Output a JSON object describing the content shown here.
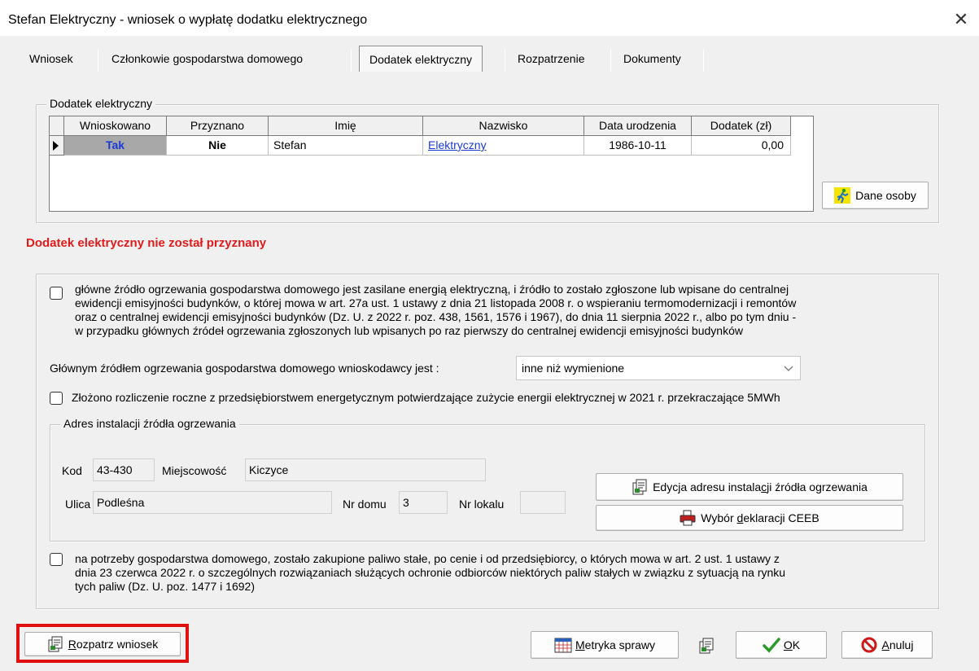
{
  "window": {
    "title": "Stefan Elektryczny - wniosek o wypłatę dodatku elektrycznego",
    "close_glyph": "✕"
  },
  "tabs": [
    {
      "label": "Wniosek",
      "active": false
    },
    {
      "label": "Członkowie gospodarstwa domowego",
      "active": false
    },
    {
      "label": "Dodatek elektryczny",
      "active": true
    },
    {
      "label": "Rozpatrzenie",
      "active": false
    },
    {
      "label": "Dokumenty",
      "active": false
    }
  ],
  "dodatek_group": {
    "label": "Dodatek elektryczny",
    "columns": [
      "Wnioskowano",
      "Przyznano",
      "Imię",
      "Nazwisko",
      "Data urodzenia",
      "Dodatek  (zł)"
    ],
    "rows": [
      {
        "wnioskowano": "Tak",
        "przyznano": "Nie",
        "imie": "Stefan",
        "nazwisko": "Elektryczny",
        "data_urodzenia": "1986-10-11",
        "dodatek": "0,00"
      }
    ],
    "dane_osoby_button": "Dane osoby"
  },
  "status_message": "Dodatek elektryczny nie został przyznany",
  "status_color": "#e01b1b",
  "conditions": {
    "heating_checkbox": {
      "checked": false,
      "lines": [
        "główne źródło ogrzewania gospodarstwa domowego jest zasilane energią elektryczną, i źródło to zostało zgłoszone lub wpisane do centralnej",
        "ewidencji emisyjności budynków, o której mowa w art. 27a ust. 1 ustawy z dnia 21 listopada 2008 r. o wspieraniu termomodernizacji i remontów",
        "oraz o centralnej ewidencji emisyjności budynków (Dz. U. z 2022 r. poz. 438, 1561, 1576 i 1967), do dnia 11 sierpnia 2022 r., albo po tym dniu -",
        "w przypadku głównych źródeł ogrzewania zgłoszonych lub wpisanych po raz pierwszy do centralnej ewidencji emisyjności budynków"
      ]
    },
    "main_source_label": "Głównym źródłem ogrzewania gospodarstwa domowego wnioskodawcy jest :",
    "main_source_value": "inne niż wymienione",
    "settlement_checkbox": {
      "checked": false,
      "text": "Złożono rozliczenie roczne z przedsiębiorstwem energetycznym potwierdzające zużycie energii elektrycznej w 2021 r. przekraczające 5MWh"
    },
    "address_group": {
      "label": "Adres instalacji źródła ogrzewania",
      "kod_label": "Kod",
      "kod_value": "43-430",
      "miejscowosc_label": "Miejscowość",
      "miejscowosc_value": "Kiczyce",
      "ulica_label": "Ulica",
      "ulica_value": "Podleśna",
      "nr_domu_label": "Nr domu",
      "nr_domu_value": "3",
      "nr_lokalu_label": "Nr lokalu",
      "nr_lokalu_value": "",
      "edit_button_pre": "Edycja adresu instala",
      "edit_button_ul": "c",
      "edit_button_post": "ji źródła ogrzewania",
      "ceeb_button_pre": "Wybór ",
      "ceeb_button_ul": "d",
      "ceeb_button_post": "eklaracji CEEB"
    },
    "fuel_checkbox": {
      "checked": false,
      "lines": [
        "na potrzeby gospodarstwa domowego, zostało zakupione paliwo stałe, po cenie i od przedsiębiorcy, o których mowa w art. 2 ust. 1 ustawy z",
        "dnia 23 czerwca 2022 r. o szczególnych rozwiązaniach służących ochronie odbiorców niektórych paliw stałych w związku z sytuacją na rynku",
        "tych paliw (Dz. U. poz. 1477 i 1692)"
      ]
    }
  },
  "footer": {
    "rozpatrz_ul": "R",
    "rozpatrz_rest": "ozpatrz wniosek",
    "metryka_pre": "M",
    "metryka_rest": "etryka sprawy",
    "ok_ul": "O",
    "ok_rest": "K",
    "anuluj_ul": "A",
    "anuluj_rest": "nuluj",
    "highlight_color": "#e01010"
  }
}
